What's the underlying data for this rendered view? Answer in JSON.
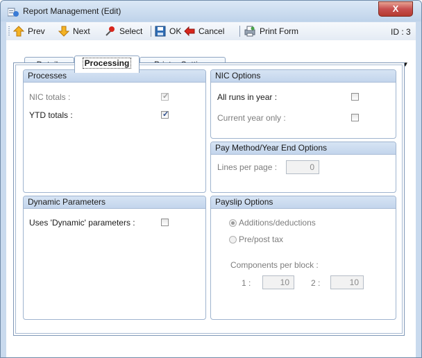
{
  "window": {
    "title": "Report Management (Edit)",
    "close_label": "X"
  },
  "toolbar": {
    "prev": "Prev",
    "next": "Next",
    "select": "Select",
    "ok": "OK",
    "cancel": "Cancel",
    "print_form": "Print Form",
    "id_label": "ID : 3"
  },
  "tabs": {
    "details": "Details",
    "processing": "Processing",
    "printer_settings": "Printer Settings",
    "active": "Processing"
  },
  "processes": {
    "title": "Processes",
    "nic_totals_label": "NIC totals :",
    "nic_totals_checked": true,
    "nic_totals_enabled": false,
    "ytd_totals_label": "YTD totals :",
    "ytd_totals_checked": true,
    "ytd_totals_enabled": true
  },
  "nic_options": {
    "title": "NIC Options",
    "all_runs_label": "All runs in year :",
    "all_runs_checked": false,
    "current_year_label": "Current year only :",
    "current_year_checked": false
  },
  "pay_method": {
    "title": "Pay Method/Year End Options",
    "lines_per_page_label": "Lines per page :",
    "lines_per_page_value": "0"
  },
  "dynamic_parameters": {
    "title": "Dynamic Parameters",
    "uses_dynamic_label": "Uses 'Dynamic' parameters :",
    "uses_dynamic_checked": false
  },
  "payslip_options": {
    "title": "Payslip Options",
    "additions_label": "Additions/deductions",
    "additions_selected": true,
    "prepost_label": "Pre/post tax",
    "prepost_selected": false,
    "components_label": "Components per block :",
    "block1_label": "1 :",
    "block1_value": "10",
    "block2_label": "2 :",
    "block2_value": "10"
  },
  "colors": {
    "title_bar": "#c9daee",
    "group_header": "#c9daf0",
    "close_button": "#c75050",
    "disabled_text": "#7d7d7d"
  }
}
